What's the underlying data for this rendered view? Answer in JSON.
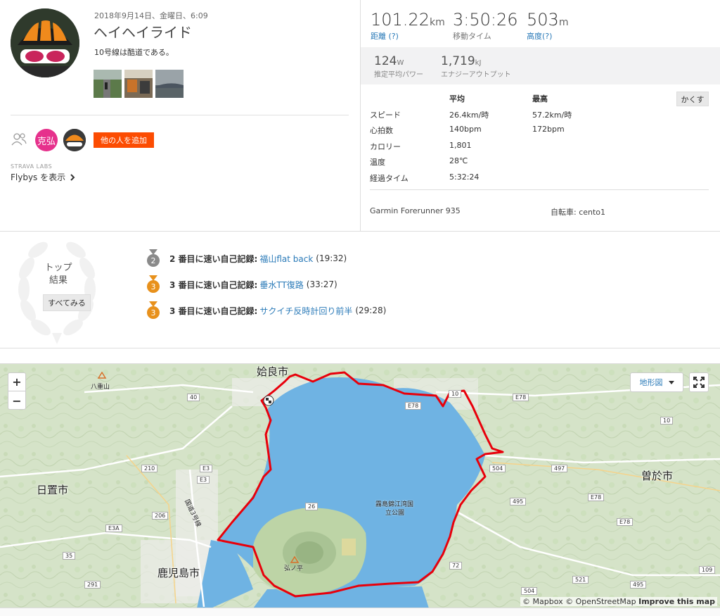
{
  "activity": {
    "date": "2018年9月14日、金曜日、6:09",
    "title": "ヘイヘイライド",
    "description": "10号線は酷道である。",
    "add_people_label": "他の人を追加",
    "athlete_initials": "克弘",
    "labs_label": "STRAVA LABS",
    "flybys_label": "Flybys を表示"
  },
  "stats": {
    "distance": {
      "value": "101.22",
      "unit": "km",
      "label": "距離 (?)"
    },
    "moving_time": {
      "value": "3:50:26",
      "label": "移動タイム"
    },
    "elevation": {
      "value": "503",
      "unit": "m",
      "label": "高度(?)"
    },
    "power": {
      "value": "124",
      "unit": "W",
      "label": "推定平均パワー"
    },
    "energy": {
      "value": "1,719",
      "unit": "kJ",
      "label": "エナジーアウトプット"
    }
  },
  "details": {
    "col_avg": "平均",
    "col_max": "最高",
    "hide_label": "かくす",
    "rows": [
      {
        "name": "スピード",
        "avg": "26.4km/時",
        "max": "57.2km/時"
      },
      {
        "name": "心拍数",
        "avg": "140bpm",
        "max": "172bpm"
      },
      {
        "name": "カロリー",
        "avg": "1,801",
        "max": ""
      },
      {
        "name": "温度",
        "avg": "28℃",
        "max": ""
      },
      {
        "name": "経過タイム",
        "avg": "5:32:24",
        "max": ""
      }
    ],
    "device": "Garmin Forerunner 935",
    "bike": "自転車: cento1"
  },
  "achievements": {
    "top_label_1": "トップ",
    "top_label_2": "結果",
    "see_all_label": "すべてみる",
    "items": [
      {
        "rank": "2",
        "text": "2 番目に速い自己記録:",
        "segment": "福山flat back",
        "time": "(19:32)",
        "color": "#8a8a8a"
      },
      {
        "rank": "3",
        "text": "3 番目に速い自己記録:",
        "segment": "垂水TT復路",
        "time": "(33:27)",
        "color": "#e8911c"
      },
      {
        "rank": "3",
        "text": "3 番目に速い自己記録:",
        "segment": "サクイチ反時計回り前半",
        "time": "(29:28)",
        "color": "#e8911c"
      }
    ]
  },
  "map": {
    "zoom_in": "+",
    "zoom_out": "−",
    "type_label": "地形図",
    "attribution_1": "© Mapbox © OpenStreetMap",
    "attribution_2": "Improve this map",
    "labels": {
      "aira": "姶良市",
      "hioki": "日置市",
      "kagoshima": "鹿児島市",
      "soo": "曽於市",
      "yaeyama": "八重山",
      "kirishima_park_1": "霧島錦江湾国",
      "kirishima_park_2": "立公園",
      "kitadake": "弘ノ平",
      "highway3": "国道3号線"
    },
    "shields": [
      "40",
      "210",
      "E3",
      "E3",
      "206",
      "E3A",
      "35",
      "291",
      "26",
      "E78",
      "10",
      "E78",
      "504",
      "497",
      "E78",
      "495",
      "E78",
      "521",
      "495",
      "109",
      "72",
      "504",
      "10"
    ],
    "colors": {
      "water": "#6fb3e3",
      "land": "#d9e6cf",
      "route": "#e8000b",
      "brand": "#fc4c02",
      "link": "#2a7ab8"
    }
  }
}
